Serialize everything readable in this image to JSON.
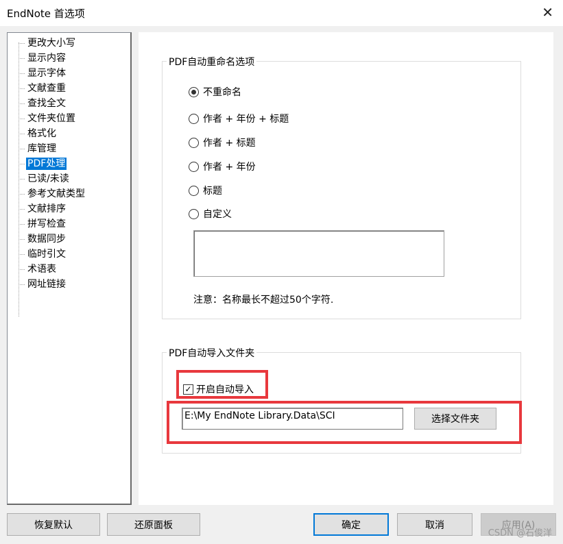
{
  "window": {
    "title": "EndNote 首选项",
    "close_glyph": "✕"
  },
  "tree": {
    "items": [
      {
        "label": "更改大小写"
      },
      {
        "label": "显示内容"
      },
      {
        "label": "显示字体"
      },
      {
        "label": "文献查重"
      },
      {
        "label": "查找全文"
      },
      {
        "label": "文件夹位置"
      },
      {
        "label": "格式化"
      },
      {
        "label": "库管理"
      },
      {
        "label": "PDF处理",
        "selected": true
      },
      {
        "label": "已读/未读"
      },
      {
        "label": "参考文献类型"
      },
      {
        "label": "文献排序"
      },
      {
        "label": "拼写检查"
      },
      {
        "label": "数据同步"
      },
      {
        "label": "临时引文"
      },
      {
        "label": "术语表"
      },
      {
        "label": "网址链接"
      }
    ]
  },
  "rename_group": {
    "title": "PDF自动重命名选项",
    "options": [
      {
        "label": "不重命名",
        "checked": true
      },
      {
        "label": "作者 + 年份 + 标题",
        "checked": false
      },
      {
        "label": "作者 + 标题",
        "checked": false
      },
      {
        "label": "作者 + 年份",
        "checked": false
      },
      {
        "label": "标题",
        "checked": false
      },
      {
        "label": "自定义",
        "checked": false
      }
    ],
    "custom_value": "",
    "note": "注意：名称最长不超过50个字符."
  },
  "import_group": {
    "title": "PDF自动导入文件夹",
    "auto_import_label": "开启自动导入",
    "auto_import_checked": true,
    "check_glyph": "✓",
    "folder_path": "E:\\My EndNote Library.Data\\SCI",
    "choose_folder_label": "选择文件夹"
  },
  "buttons": {
    "restore_defaults": "恢复默认",
    "revert_panel": "还原面板",
    "ok": "确定",
    "cancel": "取消",
    "apply": "应用(A)"
  },
  "watermark": "CSDN @石俊洋",
  "colors": {
    "selection": "#0078d7",
    "highlight_box": "#e8383d"
  }
}
